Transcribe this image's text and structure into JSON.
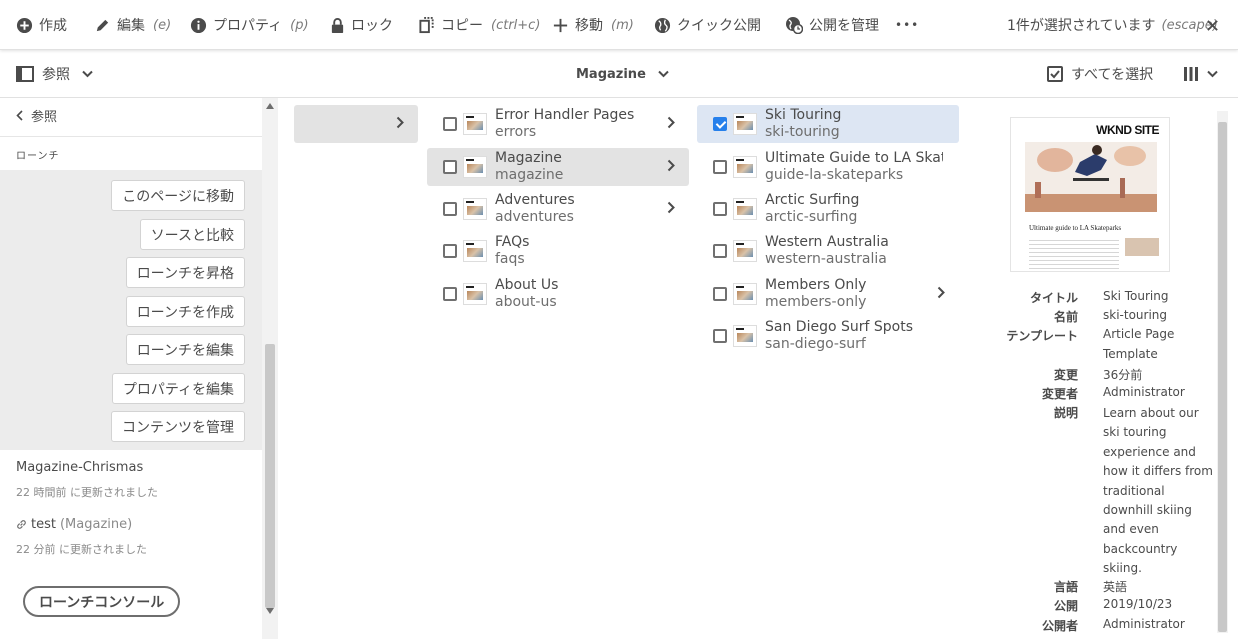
{
  "actionbar": {
    "create": "作成",
    "edit": "編集",
    "edit_hint": "(e)",
    "properties": "プロパティ",
    "properties_hint": "(p)",
    "lock": "ロック",
    "copy": "コピー",
    "copy_hint": "(ctrl+c)",
    "move": "移動",
    "move_hint": "(m)",
    "quick_publish": "クイック公開",
    "manage_publication": "公開を管理",
    "more": "•••",
    "selection_text": "1件が選択されています",
    "selection_hint": "(escape)"
  },
  "subbar": {
    "rail_toggle": "参照",
    "breadcrumb": "Magazine",
    "select_all": "すべてを選択"
  },
  "rail": {
    "back": "参照",
    "heading": "ローンチ",
    "buttons": [
      "このページに移動",
      "ソースと比較",
      "ローンチを昇格",
      "ローンチを作成",
      "ローンチを編集",
      "プロパティを編集",
      "コンテンツを管理"
    ],
    "launches": [
      {
        "title": "Magazine-Chrismas",
        "updated": "22 時間前 に更新されました"
      },
      {
        "title": "test",
        "source": "(Magazine)",
        "updated": "22 分前 に更新されました"
      }
    ],
    "console_button": "ローンチコンソール"
  },
  "column2": [
    {
      "title": "Error Handler Pages",
      "name": "errors",
      "has_children": true
    },
    {
      "title": "Magazine",
      "name": "magazine",
      "has_children": true
    },
    {
      "title": "Adventures",
      "name": "adventures",
      "has_children": true
    },
    {
      "title": "FAQs",
      "name": "faqs",
      "has_children": false
    },
    {
      "title": "About Us",
      "name": "about-us",
      "has_children": false
    }
  ],
  "column3": [
    {
      "title": "Ski Touring",
      "name": "ski-touring",
      "checked": true
    },
    {
      "title": "Ultimate Guide to LA Skat…",
      "name": "guide-la-skateparks",
      "checked": false
    },
    {
      "title": "Arctic Surfing",
      "name": "arctic-surfing",
      "checked": false
    },
    {
      "title": "Western Australia",
      "name": "western-australia",
      "checked": false
    },
    {
      "title": "Members Only",
      "name": "members-only",
      "checked": false,
      "has_children": true
    },
    {
      "title": "San Diego Surf Spots",
      "name": "san-diego-surf",
      "checked": false
    }
  ],
  "preview": {
    "site_label": "WKND SITE",
    "article_title": "Ultimate guide to LA Skateparks"
  },
  "details": {
    "title_label": "タイトル",
    "title_value": "Ski Touring",
    "name_label": "名前",
    "name_value": "ski-touring",
    "template_label": "テンプレート",
    "template_value_1": "Article Page",
    "template_value_2": "Template",
    "modified_label": "変更",
    "modified_value": "36分前",
    "modified_by_label": "変更者",
    "modified_by_value": "Administrator",
    "description_label": "説明",
    "description_value": "Learn about our ski touring experience and how it differs from traditional downhill skiing and even backcountry skiing.",
    "language_label": "言語",
    "language_value": "英語",
    "published_label": "公開",
    "published_value": "2019/10/23",
    "publisher_label": "公開者",
    "publisher_value": "Administrator"
  },
  "colors": {
    "accent": "#2680eb",
    "selected_row": "#dde6f3",
    "text": "#4b4b4b"
  }
}
